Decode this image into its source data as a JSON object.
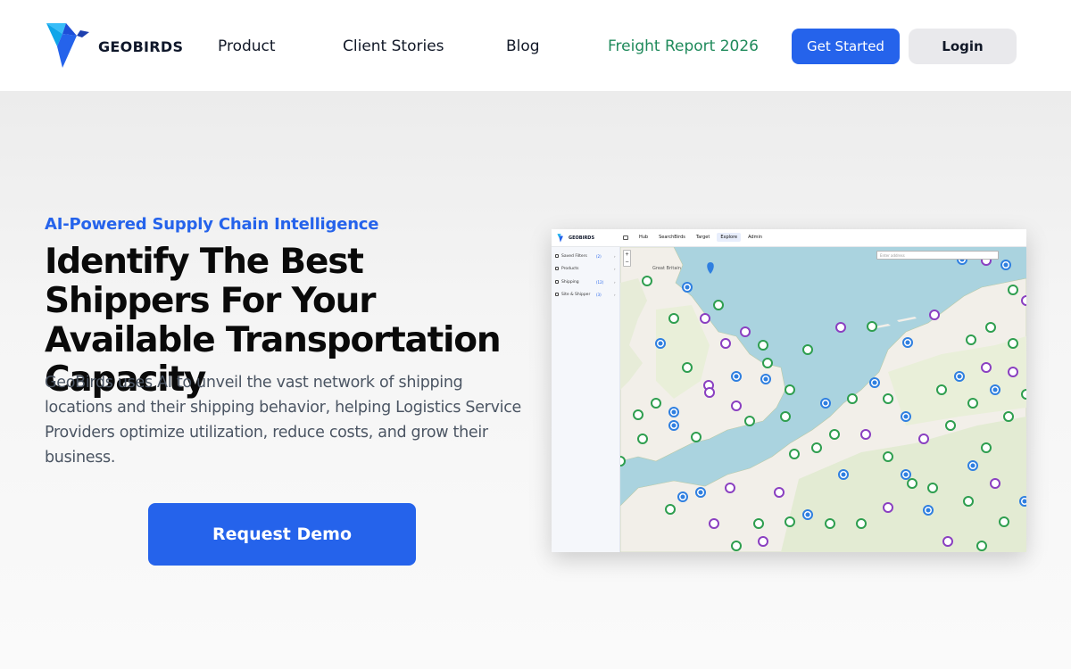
{
  "brand": {
    "name": "GEOBIRDS",
    "color": "#2563eb"
  },
  "nav": {
    "items": [
      {
        "label": "Product"
      },
      {
        "label": "Client Stories"
      },
      {
        "label": "Blog"
      },
      {
        "label": "Freight Report 2026"
      }
    ],
    "highlight_color": "#1f8a5b",
    "get_started": "Get Started",
    "login": "Login"
  },
  "hero": {
    "eyebrow": "AI-Powered Supply Chain Intelligence",
    "headline": "Identify The Best Shippers For Your Available Transportation Capacity",
    "subtext": "GeoBirds uses AI to unveil the vast network of shipping locations and their shipping behavior, helping Logistics Service Providers optimize utilization, reduce costs, and grow their business.",
    "cta": "Request Demo"
  },
  "app_preview": {
    "logo": "GEOBIRDS",
    "tabs": [
      "Hub",
      "SearchBirds",
      "Target",
      "Explore",
      "Admin"
    ],
    "active_tab": "Explore",
    "sidebar": [
      {
        "label": "Saved Filters",
        "count": "(2)"
      },
      {
        "label": "Products",
        "count": ""
      },
      {
        "label": "Shipping",
        "count": "(12)"
      },
      {
        "label": "Site & Shipper",
        "count": "(3)"
      }
    ],
    "map_search_placeholder": "Enter address",
    "map_labels": [
      "Great Britain"
    ],
    "zoom": [
      "+",
      "−"
    ]
  }
}
